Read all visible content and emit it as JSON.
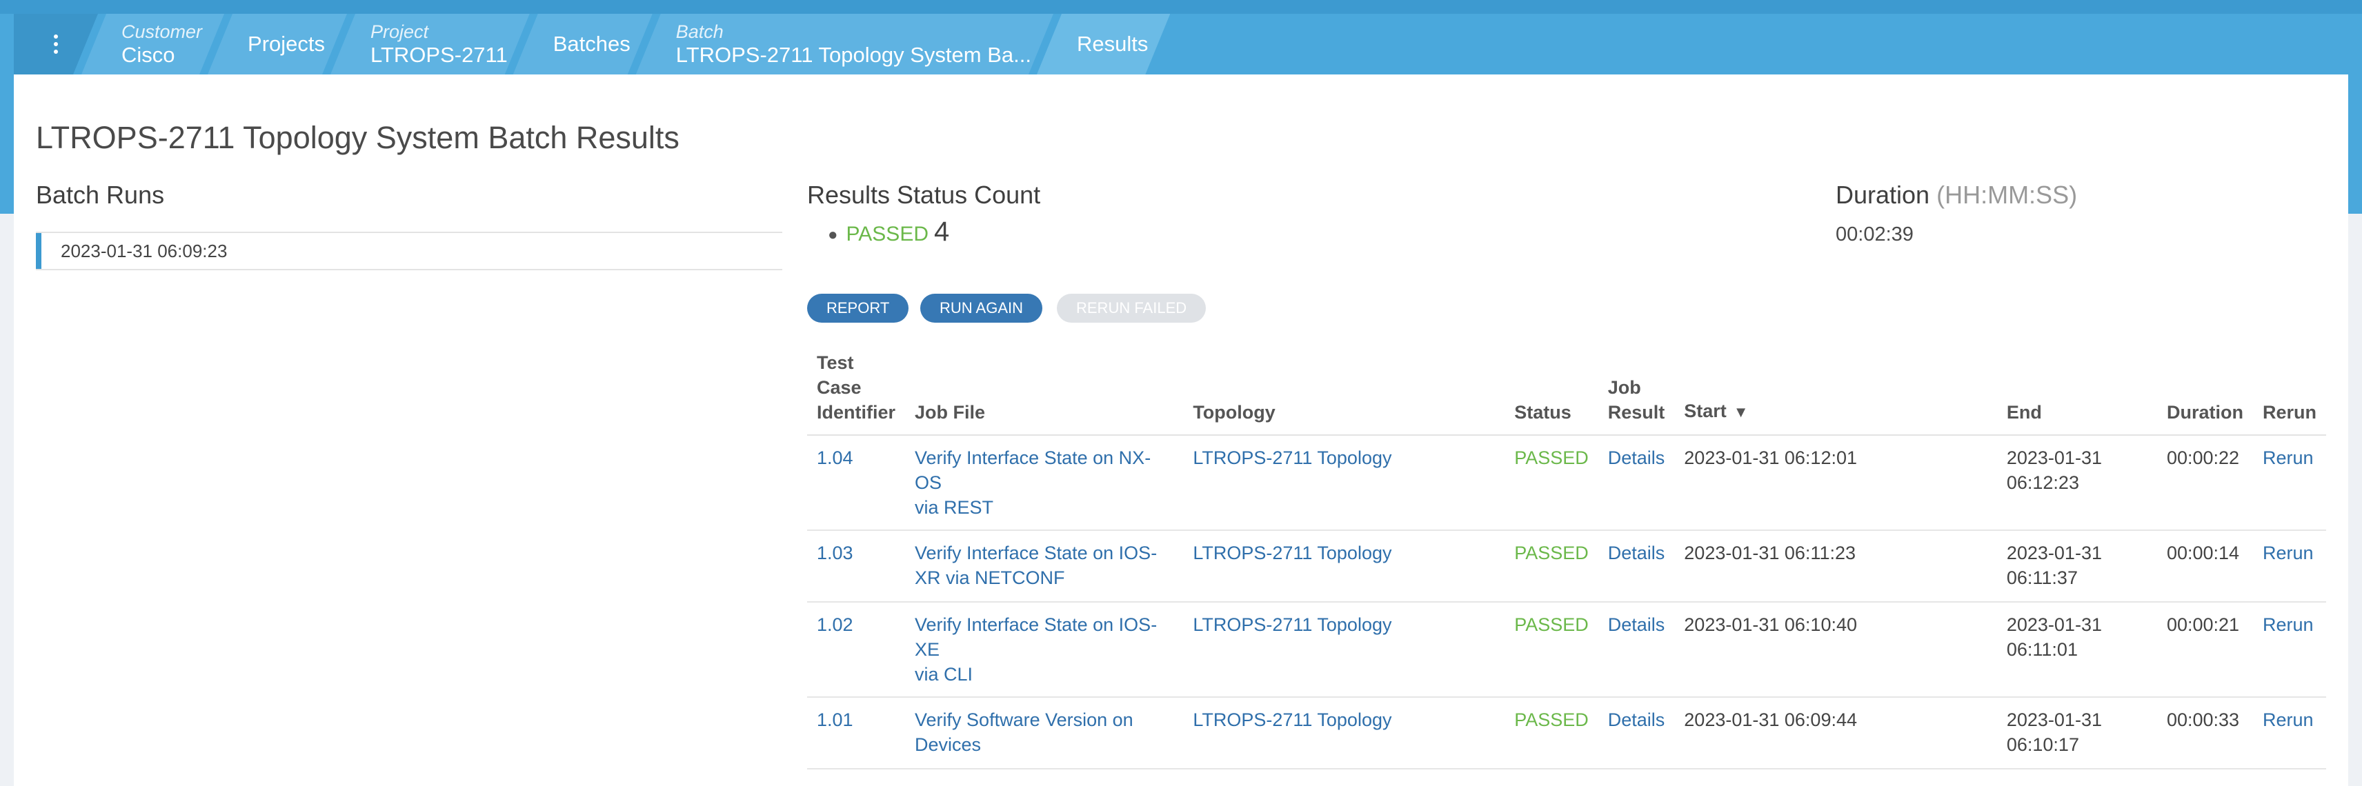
{
  "breadcrumb": {
    "menu_icon": "kebab-menu-icon",
    "customer": {
      "label": "Customer",
      "value": "Cisco"
    },
    "projects": "Projects",
    "project": {
      "label": "Project",
      "value": "LTROPS-2711"
    },
    "batches": "Batches",
    "batch": {
      "label": "Batch",
      "value": "LTROPS-2711 Topology System Ba..."
    },
    "results": "Results"
  },
  "page_title": "LTROPS-2711 Topology System Batch Results",
  "batch_runs": {
    "heading": "Batch Runs",
    "items": [
      "2023-01-31 06:09:23"
    ]
  },
  "status_count": {
    "heading": "Results Status Count",
    "items": [
      {
        "status": "PASSED",
        "count": "4"
      }
    ]
  },
  "duration": {
    "heading": "Duration",
    "unit": "(HH:MM:SS)",
    "value": "00:02:39"
  },
  "buttons": {
    "report": "REPORT",
    "run_again": "RUN AGAIN",
    "rerun_failed": "RERUN FAILED"
  },
  "table": {
    "headers": {
      "test_case": [
        "Test",
        "Case",
        "Identifier"
      ],
      "job_file": "Job File",
      "topology": "Topology",
      "status": "Status",
      "job_result": [
        "Job",
        "Result"
      ],
      "start": "Start",
      "end": "End",
      "duration": "Duration",
      "rerun": "Rerun"
    },
    "rows": [
      {
        "id": "1.04",
        "job_file": [
          "Verify Interface State on NX-OS",
          "via REST"
        ],
        "topology": "LTROPS-2711 Topology",
        "status": "PASSED",
        "job_result": "Details",
        "start": "2023-01-31 06:12:01",
        "end": [
          "2023-01-31",
          "06:12:23"
        ],
        "duration": "00:00:22",
        "rerun": "Rerun"
      },
      {
        "id": "1.03",
        "job_file": [
          "Verify Interface State on IOS-",
          "XR via NETCONF"
        ],
        "topology": "LTROPS-2711 Topology",
        "status": "PASSED",
        "job_result": "Details",
        "start": "2023-01-31 06:11:23",
        "end": [
          "2023-01-31",
          "06:11:37"
        ],
        "duration": "00:00:14",
        "rerun": "Rerun"
      },
      {
        "id": "1.02",
        "job_file": [
          "Verify Interface State on IOS-XE",
          "via CLI"
        ],
        "topology": "LTROPS-2711 Topology",
        "status": "PASSED",
        "job_result": "Details",
        "start": "2023-01-31 06:10:40",
        "end": [
          "2023-01-31",
          "06:11:01"
        ],
        "duration": "00:00:21",
        "rerun": "Rerun"
      },
      {
        "id": "1.01",
        "job_file": [
          "Verify Software Version on",
          "Devices"
        ],
        "topology": "LTROPS-2711 Topology",
        "status": "PASSED",
        "job_result": "Details",
        "start": "2023-01-31 06:09:44",
        "end": [
          "2023-01-31",
          "06:10:17"
        ],
        "duration": "00:00:33",
        "rerun": "Rerun"
      }
    ]
  },
  "colors": {
    "header_blue": "#4aa8dc",
    "accent": "#3d9ad0",
    "button": "#3778b4",
    "link": "#2f6fab",
    "passed": "#6bb84a"
  }
}
